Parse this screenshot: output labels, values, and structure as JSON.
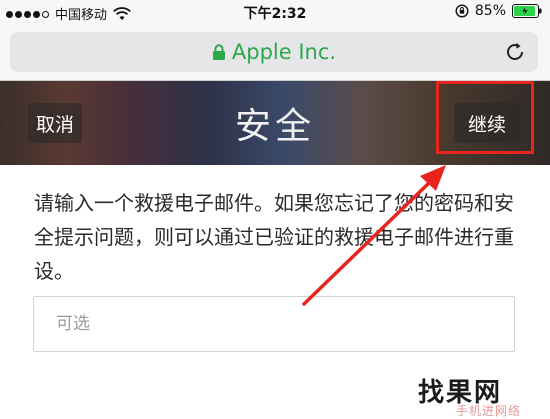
{
  "status_bar": {
    "carrier": "中国移动",
    "time": "下午2:32",
    "battery_percent": "85%"
  },
  "url_bar": {
    "site": "Apple Inc.",
    "site_color": "#2aa84a"
  },
  "nav": {
    "cancel_label": "取消",
    "title": "安全",
    "continue_label": "继续"
  },
  "content": {
    "description": "请输入一个救援电子邮件。如果您忘记了您的密码和安全提示问题，则可以通过已验证的救援电子邮件进行重设。",
    "email_input": {
      "value": "",
      "placeholder": "可选"
    }
  },
  "watermark": {
    "main": "找果网",
    "sub": "手机进网络"
  },
  "annotation": {
    "highlight_color": "#e8241f"
  },
  "icons": [
    "wifi-icon",
    "orientation-lock-icon",
    "battery-icon",
    "padlock-icon",
    "reload-icon"
  ]
}
